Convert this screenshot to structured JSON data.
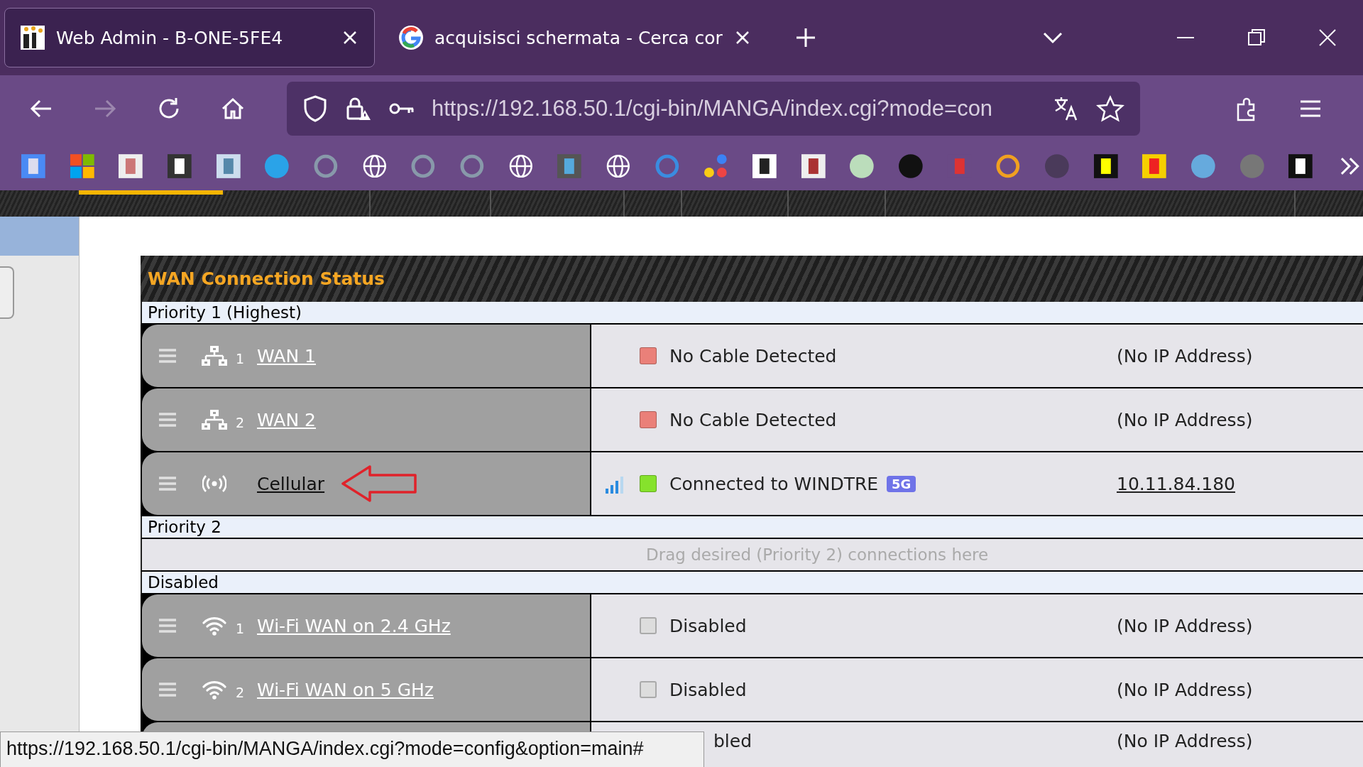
{
  "browser": {
    "tabs": [
      {
        "title": "Web Admin - B-ONE-5FE4",
        "selected": true
      },
      {
        "title": "acquisisci schermata - Cerca cor",
        "selected": false
      }
    ],
    "address": {
      "value": "https://192.168.50.1/cgi-bin/MANGA/index.cgi?mode=con"
    }
  },
  "panel": {
    "title": "WAN Connection Status",
    "groups": [
      {
        "label": "Priority 1 (Highest)",
        "connections": [
          {
            "kind": "ethernet",
            "index": "1",
            "name": "WAN 1",
            "color": "#ea8079",
            "status": "No Cable Detected",
            "ip": "(No IP Address)",
            "ip_link": false
          },
          {
            "kind": "ethernet",
            "index": "2",
            "name": "WAN 2",
            "color": "#ea8079",
            "status": "No Cable Detected",
            "ip": "(No IP Address)",
            "ip_link": false
          },
          {
            "kind": "cellular",
            "name": "Cellular",
            "color": "#86e22c",
            "status": "Connected to WINDTRE",
            "band": "5G",
            "ip": "10.11.84.180",
            "ip_link": true,
            "highlighted": true
          }
        ]
      },
      {
        "label": "Priority 2",
        "placeholder": "Drag desired (Priority 2) connections here"
      },
      {
        "label": "Disabled",
        "connections": [
          {
            "kind": "wifi",
            "index": "1",
            "name": "Wi-Fi WAN on 2.4 GHz",
            "checked": false,
            "status": "Disabled",
            "ip": "(No IP Address)",
            "ip_link": false
          },
          {
            "kind": "wifi",
            "index": "2",
            "name": "Wi-Fi WAN on 5 GHz",
            "checked": false,
            "status": "Disabled",
            "ip": "(No IP Address)",
            "ip_link": false
          },
          {
            "kind": "covered",
            "status": "bled",
            "ip": "(No IP Address)"
          }
        ]
      }
    ]
  },
  "status_tooltip": "https://192.168.50.1/cgi-bin/MANGA/index.cgi?mode=config&option=main#"
}
